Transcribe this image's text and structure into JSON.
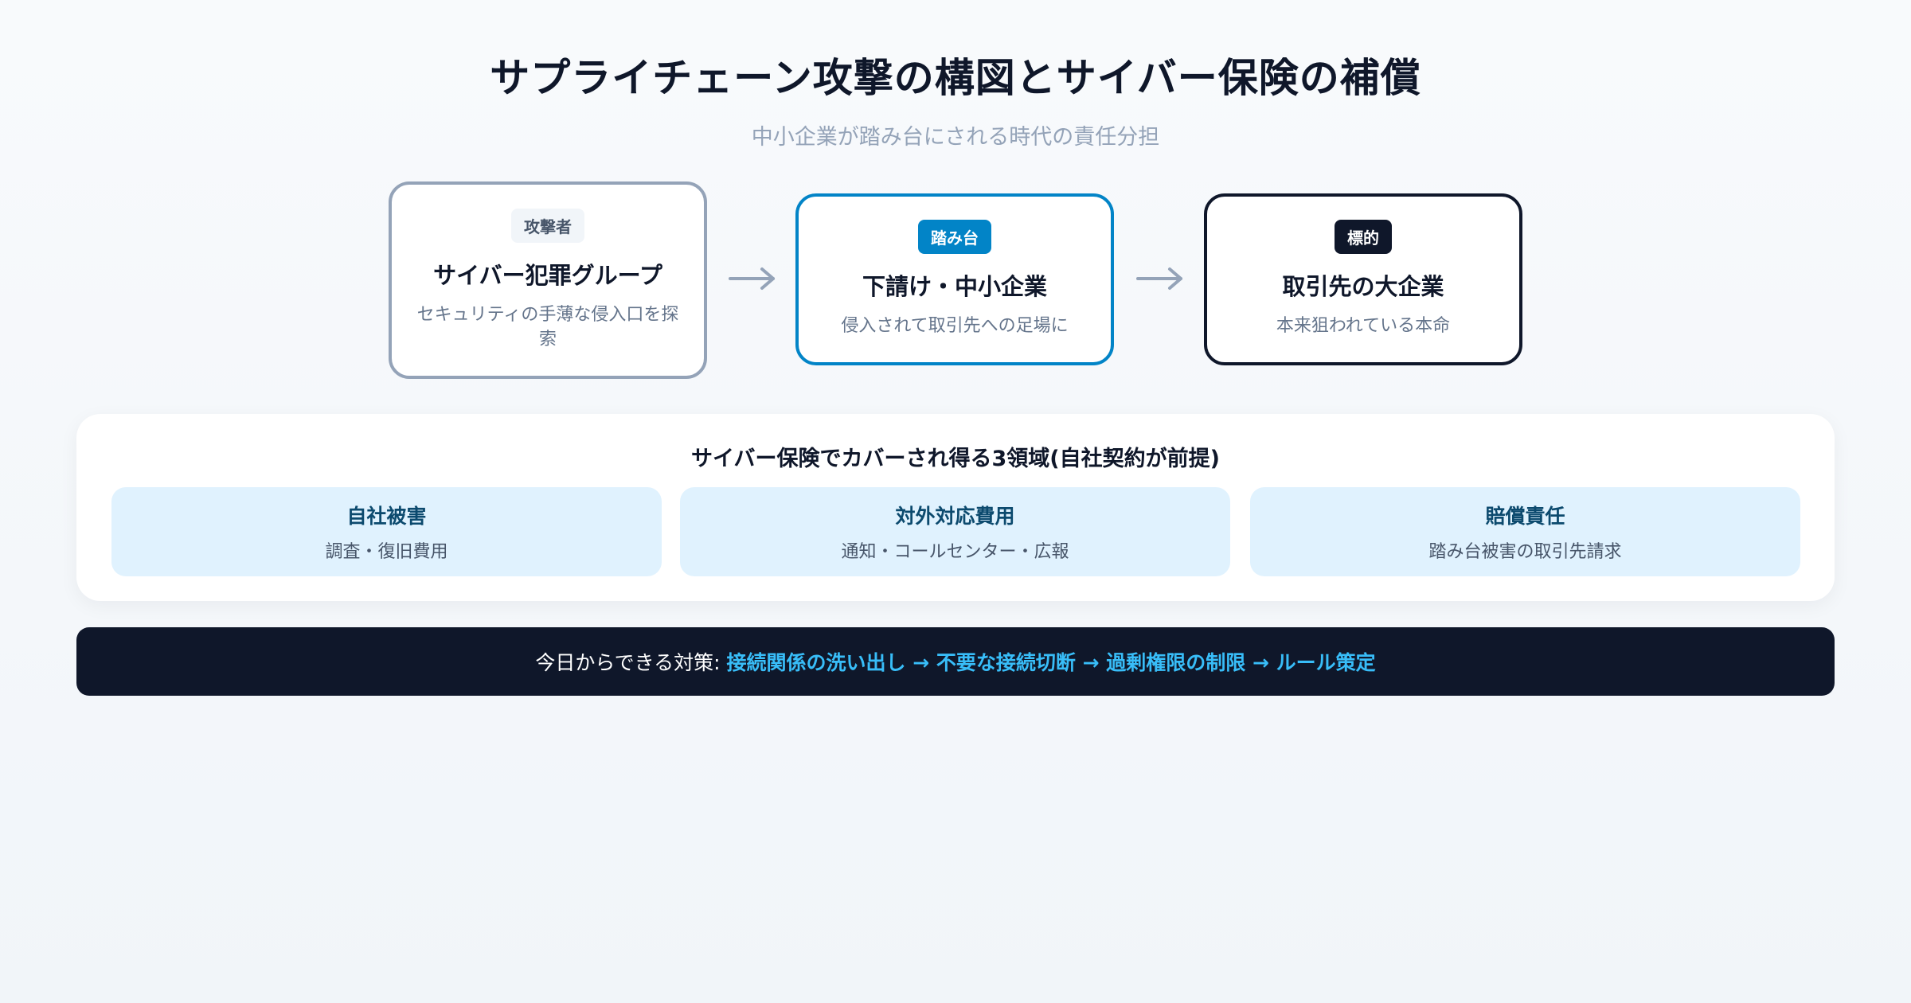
{
  "header": {
    "title": "サプライチェーン攻撃の構図とサイバー保険の補償",
    "subtitle": "中小企業が踏み台にされる時代の責任分担"
  },
  "flow": {
    "attacker": {
      "badge": "攻撃者",
      "title": "サイバー犯罪グループ",
      "desc": "セキュリティの手薄な侵入口を探索"
    },
    "stepping_stone": {
      "badge": "踏み台",
      "title": "下請け・中小企業",
      "desc": "侵入されて取引先への足場に"
    },
    "target": {
      "badge": "標的",
      "title": "取引先の大企業",
      "desc": "本来狙われている本命"
    }
  },
  "coverage": {
    "title": "サイバー保険でカバーされ得る3領域(自社契約が前提)",
    "items": [
      {
        "title": "自社被害",
        "desc": "調査・復旧費用"
      },
      {
        "title": "対外対応費用",
        "desc": "通知・コールセンター・広報"
      },
      {
        "title": "賠償責任",
        "desc": "踏み台被害の取引先請求"
      }
    ]
  },
  "actions": {
    "label": "今日からできる対策:",
    "steps": "接続関係の洗い出し → 不要な接続切断 → 過剰権限の制限 → ルール策定"
  },
  "colors": {
    "attacker_border": "#94a3b8",
    "stepping_accent": "#0284c7",
    "target_accent": "#0f172a",
    "coverage_bg": "#e0f2fe",
    "action_highlight": "#38bdf8"
  },
  "icons": {
    "flow_arrow": "right-arrow-icon"
  }
}
